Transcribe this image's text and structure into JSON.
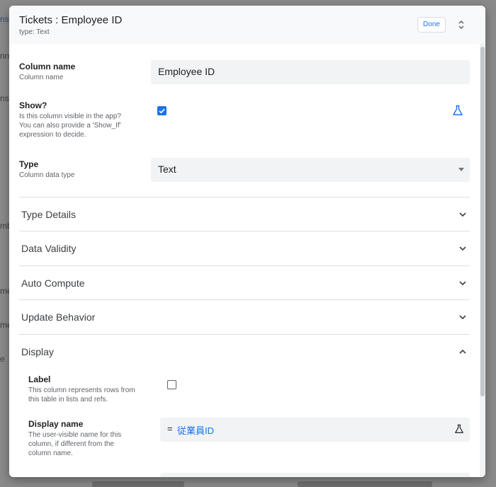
{
  "dialog": {
    "title": "Tickets : Employee ID",
    "subtitle": "type: Text",
    "done_label": "Done"
  },
  "fields": {
    "column_name": {
      "label": "Column name",
      "description": "Column name",
      "value": "Employee ID"
    },
    "show": {
      "label": "Show?",
      "description_lines": [
        "Is this column visible in the app?",
        "You can also provide a 'Show_If'",
        "expression to decide."
      ],
      "checked": true
    },
    "type": {
      "label": "Type",
      "description": "Column data type",
      "value": "Text"
    }
  },
  "sections": [
    {
      "label": "Type Details",
      "expanded": false
    },
    {
      "label": "Data Validity",
      "expanded": false
    },
    {
      "label": "Auto Compute",
      "expanded": false
    },
    {
      "label": "Update Behavior",
      "expanded": false
    },
    {
      "label": "Display",
      "expanded": true
    }
  ],
  "display": {
    "label_field": {
      "label": "Label",
      "description_lines": [
        "This column represents rows from",
        "this table in lists and refs."
      ],
      "checked": false
    },
    "display_name": {
      "label": "Display name",
      "description_lines": [
        "The user-visible name for this",
        "column, if different from the",
        "column name."
      ],
      "prefix": "=",
      "value": "従業員ID"
    }
  },
  "background_fragments": [
    "ns",
    "nn",
    "ns",
    "mb",
    "me",
    "me",
    "e"
  ],
  "colors": {
    "accent": "#1a73e8",
    "header_bg": "#f8f9fa",
    "field_bg": "#f1f3f4"
  }
}
